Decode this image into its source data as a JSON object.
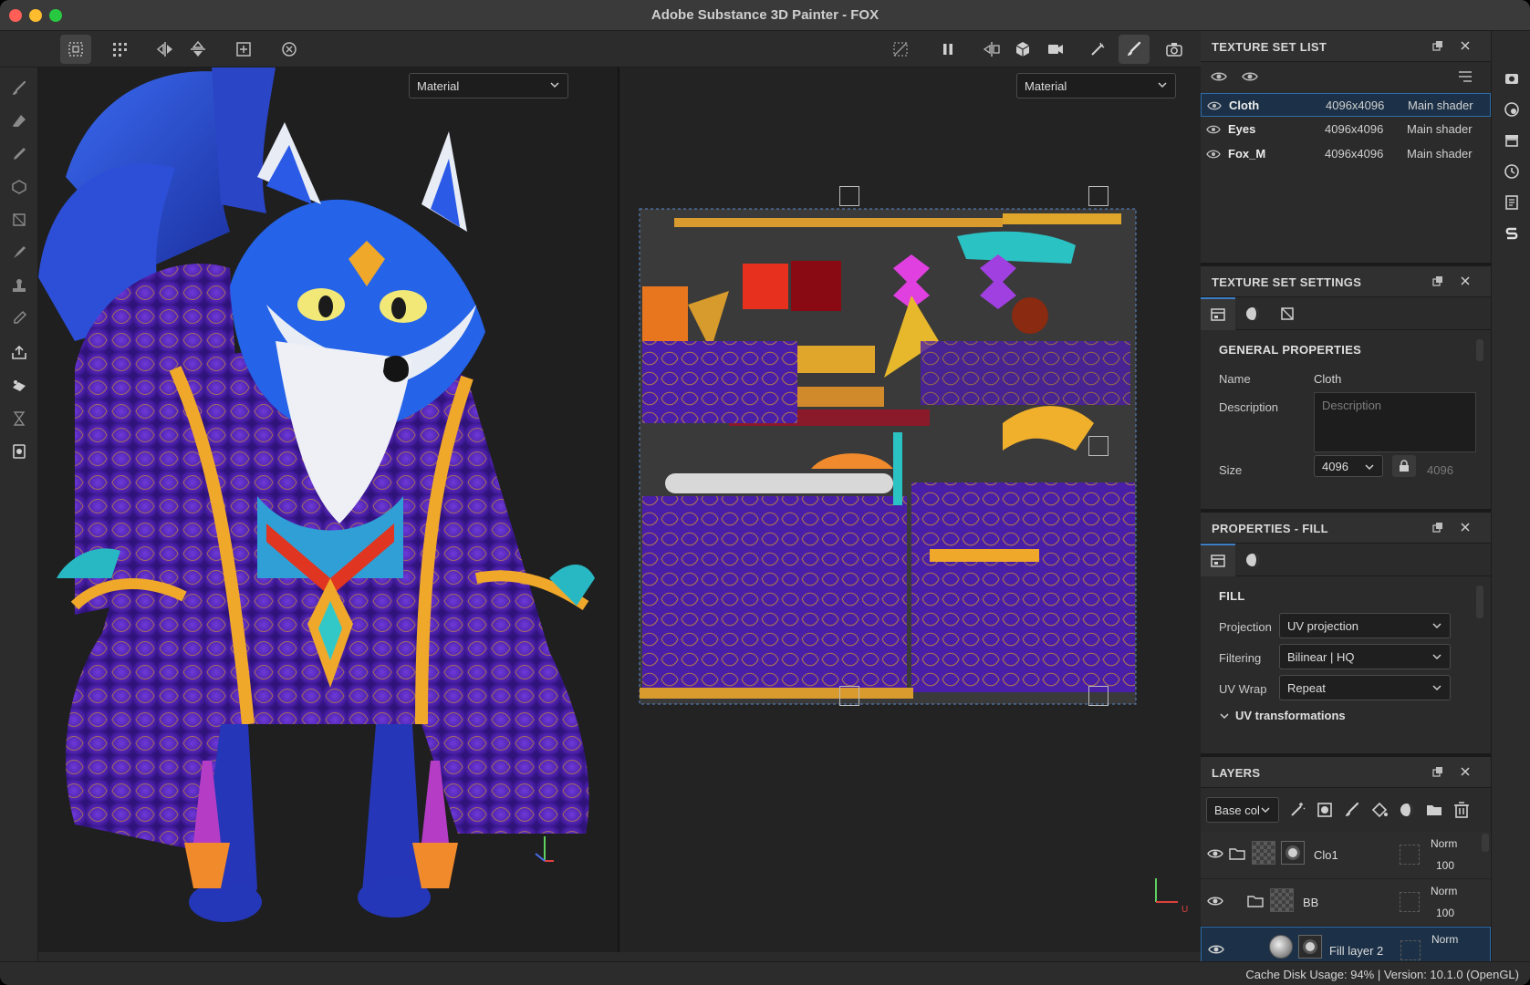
{
  "window": {
    "title": "Adobe Substance 3D Painter - FOX"
  },
  "viewport3d": {
    "mode_select": "Material"
  },
  "viewport2d": {
    "mode_select": "Material",
    "axis_x": "U"
  },
  "texture_set_list": {
    "title": "TEXTURE SET LIST",
    "rows": [
      {
        "name": "Cloth",
        "size": "4096x4096",
        "shader": "Main shader",
        "selected": true
      },
      {
        "name": "Eyes",
        "size": "4096x4096",
        "shader": "Main shader",
        "selected": false
      },
      {
        "name": "Fox_M",
        "size": "4096x4096",
        "shader": "Main shader",
        "selected": false
      }
    ]
  },
  "texture_set_settings": {
    "title": "TEXTURE SET SETTINGS",
    "section": "GENERAL PROPERTIES",
    "name_label": "Name",
    "name_value": "Cloth",
    "description_label": "Description",
    "description_placeholder": "Description",
    "size_label": "Size",
    "size_value": "4096",
    "size_locked_value": "4096"
  },
  "properties_fill": {
    "title": "PROPERTIES - FILL",
    "section": "FILL",
    "projection_label": "Projection",
    "projection_value": "UV projection",
    "filtering_label": "Filtering",
    "filtering_value": "Bilinear | HQ",
    "uvwrap_label": "UV Wrap",
    "uvwrap_value": "Repeat",
    "uv_transformations": "UV transformations"
  },
  "layers": {
    "title": "LAYERS",
    "channel_select": "Base col",
    "rows": [
      {
        "name": "Clo1",
        "blend": "Norm",
        "opacity": "100"
      },
      {
        "name": "BB",
        "blend": "Norm",
        "opacity": "100"
      },
      {
        "name": "Fill layer 2",
        "blend": "Norm",
        "opacity": ""
      }
    ]
  },
  "status": {
    "text": "Cache Disk Usage:    94% | Version: 10.1.0 (OpenGL)"
  },
  "colors": {
    "accent": "#2f6ca8",
    "selected_bg": "#1c3147",
    "panel_bg": "#2b2b2b"
  }
}
